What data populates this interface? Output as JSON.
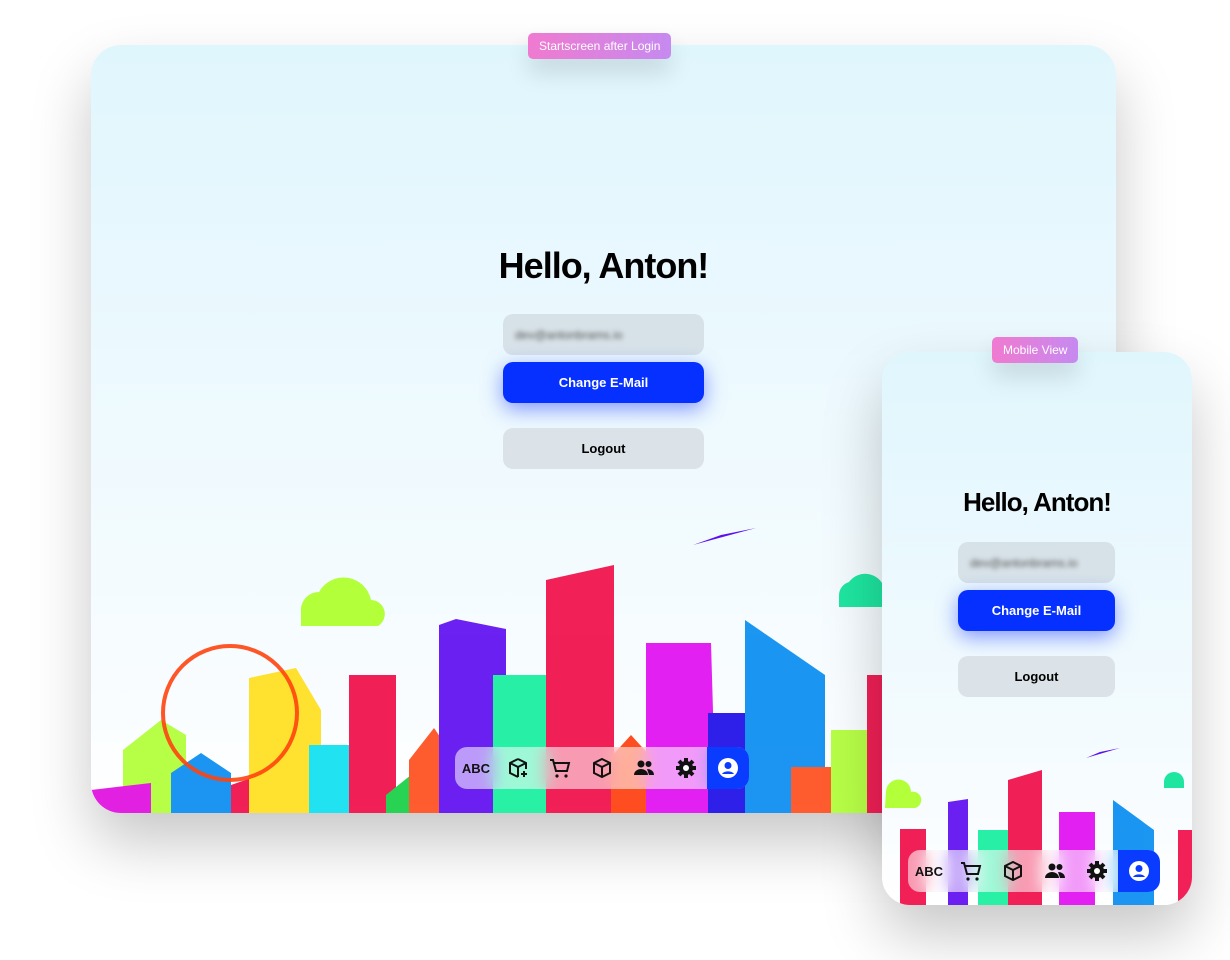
{
  "labels": {
    "desktop": "Startscreen after Login",
    "mobile": "Mobile View"
  },
  "screen": {
    "greeting": "Hello, Anton!",
    "email": "dev@antonbrams.io",
    "change_email": "Change E-Mail",
    "logout": "Logout"
  },
  "nav": {
    "desktop": [
      "abc-icon",
      "box-add-icon",
      "cart-icon",
      "box-icon",
      "users-icon",
      "gear-icon",
      "account-icon"
    ],
    "mobile": [
      "abc-icon",
      "cart-icon",
      "box-icon",
      "users-icon",
      "gear-icon",
      "account-icon"
    ],
    "abc": "ABC",
    "active": "account-icon"
  },
  "colors": {
    "primary": "#0530ff",
    "tag": "#e67ad6"
  }
}
